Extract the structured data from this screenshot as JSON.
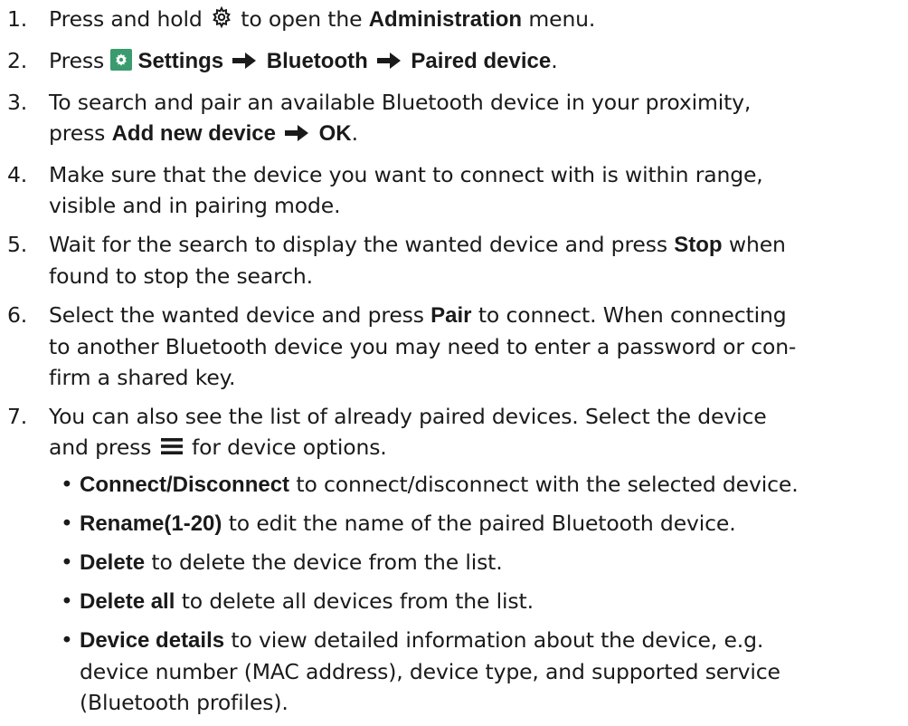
{
  "steps": [
    {
      "num": "1.",
      "pre": "Press and hold",
      "post": "to open the",
      "bold": "Administration",
      "end": "menu."
    },
    {
      "num": "2.",
      "pre": "Press",
      "b1": "Settings",
      "b2": "Bluetooth",
      "b3": "Paired device",
      "end": "."
    },
    {
      "num": "3.",
      "text": "To search and pair an available Bluetooth device in your proximity,",
      "pre2": "press",
      "b1": "Add new device",
      "b2": "OK",
      "end": "."
    },
    {
      "num": "4.",
      "line1": "Make sure that the device you want to connect with is within range,",
      "line2": "visible and in pairing mode."
    },
    {
      "num": "5.",
      "pre": "Wait for the search to display the wanted device and press",
      "bold": "Stop",
      "post": "when",
      "line2": "found to stop the search."
    },
    {
      "num": "6.",
      "pre": "Select the wanted device and press",
      "bold": "Pair",
      "post": "to connect. When connecting",
      "line2": "to another Bluetooth device you may need to enter a password or con-",
      "line3": "firm a shared key."
    },
    {
      "num": "7.",
      "line1": "You can also see the list of already paired devices. Select the device",
      "pre2": "and press",
      "post2": "for device options."
    }
  ],
  "bullets": [
    {
      "dot": "•",
      "b1": "Connect",
      "sep": "/",
      "b2": "Disconnect",
      "text": "to connect/disconnect with the selected device."
    },
    {
      "dot": "•",
      "b1": "Rename(1-20)",
      "text": "to edit the name of the paired Bluetooth device."
    },
    {
      "dot": "•",
      "b1": "Delete",
      "text": "to delete the device from the list."
    },
    {
      "dot": "•",
      "b1": "Delete all",
      "text": "to delete all devices from the list."
    },
    {
      "dot": "•",
      "b1": "Device details",
      "text": "to view detailed information about the device, e.g.",
      "line2": "device number (MAC address), device type, and supported service",
      "line3": "(Bluetooth profiles)."
    }
  ],
  "icons": {
    "admin": "gear-icon",
    "settings": "settings-app-icon",
    "arrow": "right-arrow-icon",
    "menu": "hamburger-menu-icon",
    "settings_color": "#3a9b6e"
  }
}
